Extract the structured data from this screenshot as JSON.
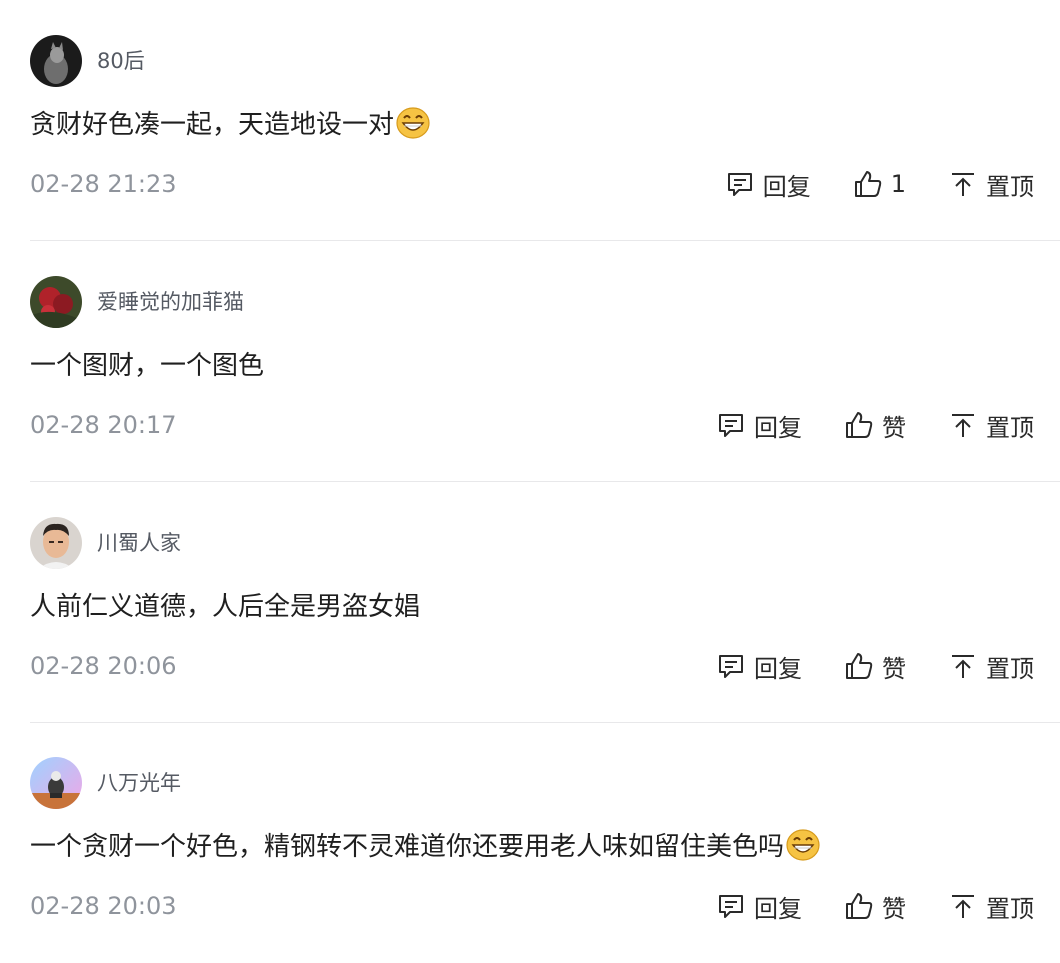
{
  "comments": [
    {
      "username": "80后",
      "content": "贪财好色凑一起，天造地设一对",
      "emoji": "grinning-emoji",
      "time": "02-28 21:23",
      "reply_label": "回复",
      "like_label": "1",
      "pin_label": "置顶"
    },
    {
      "username": "爱睡觉的加菲猫",
      "content": "一个图财，一个图色",
      "emoji": "",
      "time": "02-28 20:17",
      "reply_label": "回复",
      "like_label": "赞",
      "pin_label": "置顶"
    },
    {
      "username": "川蜀人家",
      "content": "人前仁义道德，人后全是男盗女娼",
      "emoji": "",
      "time": "02-28 20:06",
      "reply_label": "回复",
      "like_label": "赞",
      "pin_label": "置顶"
    },
    {
      "username": "八万光年",
      "content": "一个贪财一个好色，精钢转不灵难道你还要用老人味如留住美色吗",
      "emoji": "grinning-emoji",
      "time": "02-28 20:03",
      "reply_label": "回复",
      "like_label": "赞",
      "pin_label": "置顶"
    }
  ],
  "icons": {
    "reply": "comment-icon",
    "like": "thumbs-up-icon",
    "pin": "pin-to-top-icon"
  },
  "colors": {
    "text": "#1f1f1f",
    "username": "#555a63",
    "timestamp": "#8f949c",
    "divider": "#e8e8ea",
    "emoji": "#f6c343"
  }
}
